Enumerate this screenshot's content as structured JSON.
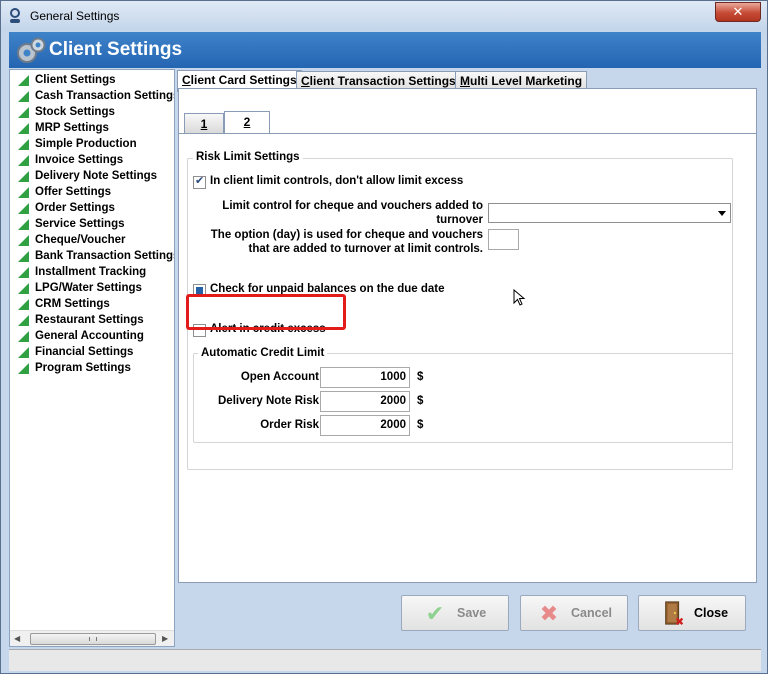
{
  "window": {
    "title": "General Settings",
    "close_label": "✕"
  },
  "header": {
    "title": "Client Settings"
  },
  "sidebar": {
    "items": [
      "Client Settings",
      "Cash Transaction Settings",
      "Stock Settings",
      "MRP Settings",
      "Simple Production",
      "Invoice Settings",
      "Delivery Note Settings",
      "Offer Settings",
      "Order Settings",
      "Service Settings",
      "Cheque/Voucher",
      "Bank Transaction Settings",
      "Installment Tracking",
      "LPG/Water Settings",
      "CRM Settings",
      "Restaurant Settings",
      "General Accounting",
      "Financial Settings",
      "Program Settings"
    ]
  },
  "tabs": {
    "client_card": {
      "underline": "C",
      "rest": "lient Card Settings"
    },
    "client_transaction": {
      "underline": "C",
      "rest": "lient Transaction Settings"
    },
    "multi_level": {
      "underline": "M",
      "rest": "ulti Level Marketing"
    },
    "inner_1": "1",
    "inner_2": "2"
  },
  "risk_limit": {
    "group_title": "Risk Limit Settings",
    "no_limit_excess_label": "In client limit controls, don't allow limit excess",
    "no_limit_excess_checked": true,
    "limit_control_label_1": "Limit control for cheque and vouchers added to",
    "limit_control_label_2": "turnover",
    "limit_control_value": "",
    "option_day_label_1": "The option (day) is used for cheque and vouchers",
    "option_day_label_2": "that are added to turnover at limit controls.",
    "option_day_value": "",
    "unpaid_balance_label": "Check for unpaid balances on the due date",
    "unpaid_balance_state": "indeterminate",
    "alert_credit_excess_label": "Alert in credit excess",
    "alert_credit_excess_checked": false
  },
  "auto_credit": {
    "group_title": "Automatic Credit Limit",
    "rows": [
      {
        "label": "Open Account",
        "value": "1000",
        "unit": "$"
      },
      {
        "label": "Delivery Note Risk",
        "value": "2000",
        "unit": "$"
      },
      {
        "label": "Order Risk",
        "value": "2000",
        "unit": "$"
      }
    ]
  },
  "buttons": {
    "save": "Save",
    "cancel": "Cancel",
    "close": "Close"
  },
  "colors": {
    "header": "#2d6fbc",
    "accent_red": "#e31b1b",
    "sidebar_icon": "#31a042"
  }
}
